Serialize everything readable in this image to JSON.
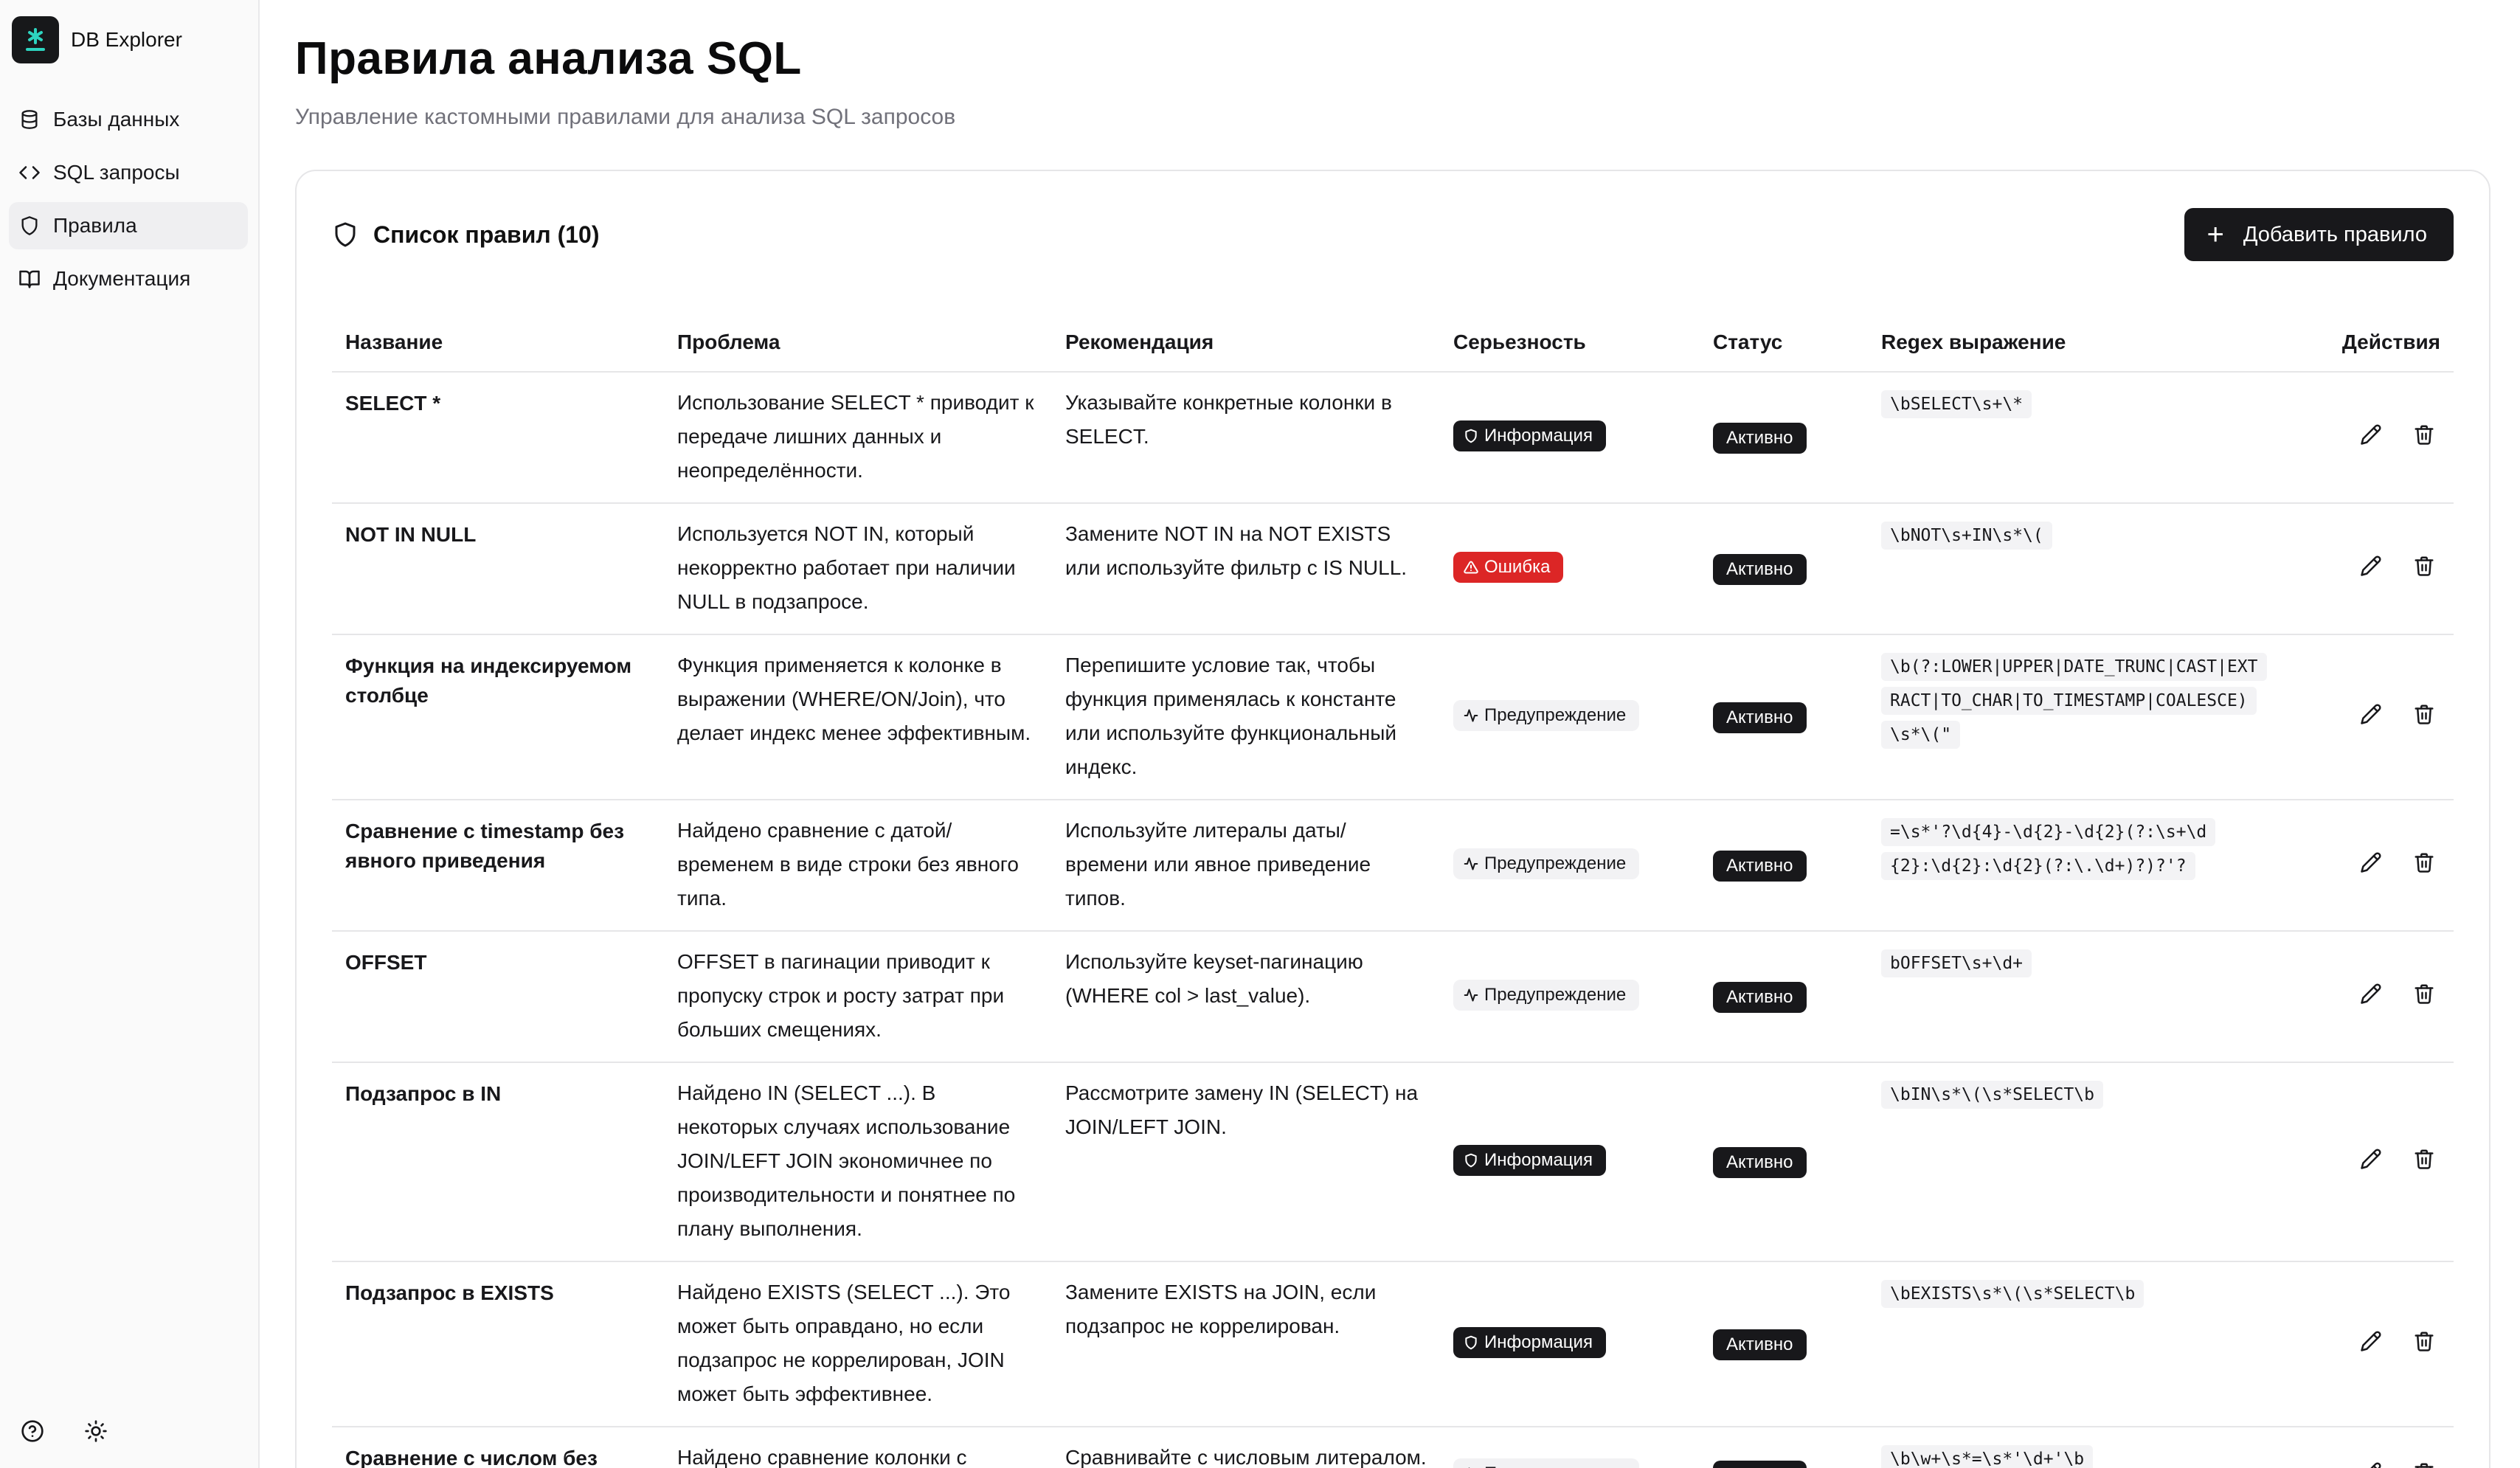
{
  "app": {
    "name": "DB Explorer"
  },
  "sidebar": {
    "items": [
      {
        "label": "Базы данных",
        "icon": "database-icon",
        "active": false
      },
      {
        "label": "SQL запросы",
        "icon": "code-icon",
        "active": false
      },
      {
        "label": "Правила",
        "icon": "shield-icon",
        "active": true
      },
      {
        "label": "Документация",
        "icon": "book-icon",
        "active": false
      }
    ],
    "bottom": {
      "help_icon": "help-circle-icon",
      "theme_icon": "sun-icon"
    }
  },
  "page": {
    "title": "Правила анализа SQL",
    "subtitle": "Управление кастомными правилами для анализа SQL запросов"
  },
  "card": {
    "title": "Список правил (10)",
    "add_button": "Добавить правило"
  },
  "table": {
    "headers": {
      "name": "Название",
      "problem": "Проблема",
      "recommendation": "Рекомендация",
      "severity": "Серьезность",
      "status": "Статус",
      "regex": "Regex выражение",
      "actions": "Действия"
    },
    "rows": [
      {
        "name": "SELECT *",
        "problem": "Использование SELECT * приводит к передаче лишних данных и неопределённости.",
        "recommendation": "Указывайте конкретные колонки в SELECT.",
        "severity": "Информация",
        "severity_type": "info",
        "status": "Активно",
        "regex": "\\bSELECT\\s+\\*"
      },
      {
        "name": "NOT IN NULL",
        "problem": "Используется NOT IN, который некорректно работает при наличии NULL в подзапросе.",
        "recommendation": "Замените NOT IN на NOT EXISTS или используйте фильтр с IS NULL.",
        "severity": "Ошибка",
        "severity_type": "error",
        "status": "Активно",
        "regex": "\\bNOT\\s+IN\\s*\\("
      },
      {
        "name": "Функция на индексируемом столбце",
        "problem": "Функция применяется к колонке в выражении (WHERE/ON/Join), что делает индекс менее эффективным.",
        "recommendation": "Перепишите условие так, чтобы функция применялась к константе или используйте функциональный индекс.",
        "severity": "Предупреждение",
        "severity_type": "warn",
        "status": "Активно",
        "regex": "\\b(?:LOWER|UPPER|DATE_TRUNC|CAST|EXTRACT|TO_CHAR|TO_TIMESTAMP|COALESCE)\\s*\\(\""
      },
      {
        "name": "Сравнение с timestamp без явного приведения",
        "problem": "Найдено сравнение с датой/временем в виде строки без явного типа.",
        "recommendation": "Используйте литералы даты/времени или явное приведение типов.",
        "severity": "Предупреждение",
        "severity_type": "warn",
        "status": "Активно",
        "regex": "=\\s*'?\\d{4}-\\d{2}-\\d{2}(?:\\s+\\d{2}:\\d{2}:\\d{2}(?:\\.\\d+)?)?'?"
      },
      {
        "name": "OFFSET",
        "problem": "OFFSET в пагинации приводит к пропуску строк и росту затрат при больших смещениях.",
        "recommendation": "Используйте keyset-пагинацию (WHERE col > last_value).",
        "severity": "Предупреждение",
        "severity_type": "warn",
        "status": "Активно",
        "regex": "bOFFSET\\s+\\d+"
      },
      {
        "name": "Подзапрос в IN",
        "problem": "Найдено IN (SELECT ...). В некоторых случаях использование JOIN/LEFT JOIN экономичнее по производительности и понятнее по плану выполнения.",
        "recommendation": "Рассмотрите замену IN (SELECT) на JOIN/LEFT JOIN.",
        "severity": "Информация",
        "severity_type": "info",
        "status": "Активно",
        "regex": "\\bIN\\s*\\(\\s*SELECT\\b"
      },
      {
        "name": "Подзапрос в EXISTS",
        "problem": "Найдено EXISTS (SELECT ...). Это может быть оправдано, но если подзапрос не коррелирован, JOIN может быть эффективнее.",
        "recommendation": "Замените EXISTS на JOIN, если подзапрос не коррелирован.",
        "severity": "Информация",
        "severity_type": "info",
        "status": "Активно",
        "regex": "\\bEXISTS\\s*\\(\\s*SELECT\\b"
      },
      {
        "name": "Сравнение с числом без явного приведения",
        "problem": "Найдено сравнение колонки с числовой строкой.",
        "recommendation": "Сравнивайте с числовым литералом.",
        "severity": "Предупреждение",
        "severity_type": "warn",
        "status": "Активно",
        "regex": "\\b\\w+\\s*=\\s*'\\d+'\\b"
      }
    ]
  },
  "colors": {
    "primary": "#18181b",
    "error": "#dc2626",
    "warn_bg": "#f2f2f4",
    "logo_accent": "#2dd4bf"
  }
}
